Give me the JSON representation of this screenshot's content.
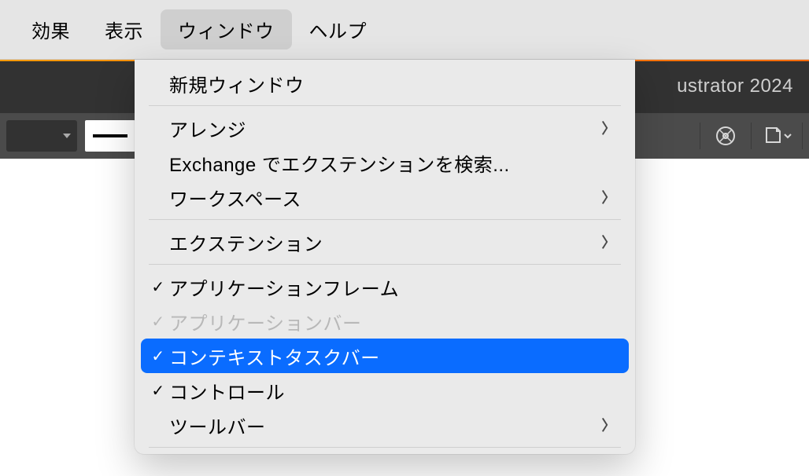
{
  "menubar": {
    "items": [
      {
        "label": "効果",
        "active": false
      },
      {
        "label": "表示",
        "active": false
      },
      {
        "label": "ウィンドウ",
        "active": true
      },
      {
        "label": "ヘルプ",
        "active": false
      }
    ]
  },
  "tabbar": {
    "title_fragment": "ustrator 2024"
  },
  "dropdown": {
    "groups": [
      [
        {
          "label": "新規ウィンドウ",
          "check": "",
          "submenu": false,
          "disabled": false,
          "highlighted": false
        }
      ],
      [
        {
          "label": "アレンジ",
          "check": "",
          "submenu": true,
          "disabled": false,
          "highlighted": false
        },
        {
          "label": "Exchange でエクステンションを検索...",
          "check": "",
          "submenu": false,
          "disabled": false,
          "highlighted": false
        },
        {
          "label": "ワークスペース",
          "check": "",
          "submenu": true,
          "disabled": false,
          "highlighted": false
        }
      ],
      [
        {
          "label": "エクステンション",
          "check": "",
          "submenu": true,
          "disabled": false,
          "highlighted": false
        }
      ],
      [
        {
          "label": "アプリケーションフレーム",
          "check": "✓",
          "submenu": false,
          "disabled": false,
          "highlighted": false
        },
        {
          "label": "アプリケーションバー",
          "check": "✓",
          "submenu": false,
          "disabled": true,
          "highlighted": false
        },
        {
          "label": "コンテキストタスクバー",
          "check": "✓",
          "submenu": false,
          "disabled": false,
          "highlighted": true
        },
        {
          "label": "コントロール",
          "check": "✓",
          "submenu": false,
          "disabled": false,
          "highlighted": false
        },
        {
          "label": "ツールバー",
          "check": "",
          "submenu": true,
          "disabled": false,
          "highlighted": false
        }
      ]
    ]
  }
}
